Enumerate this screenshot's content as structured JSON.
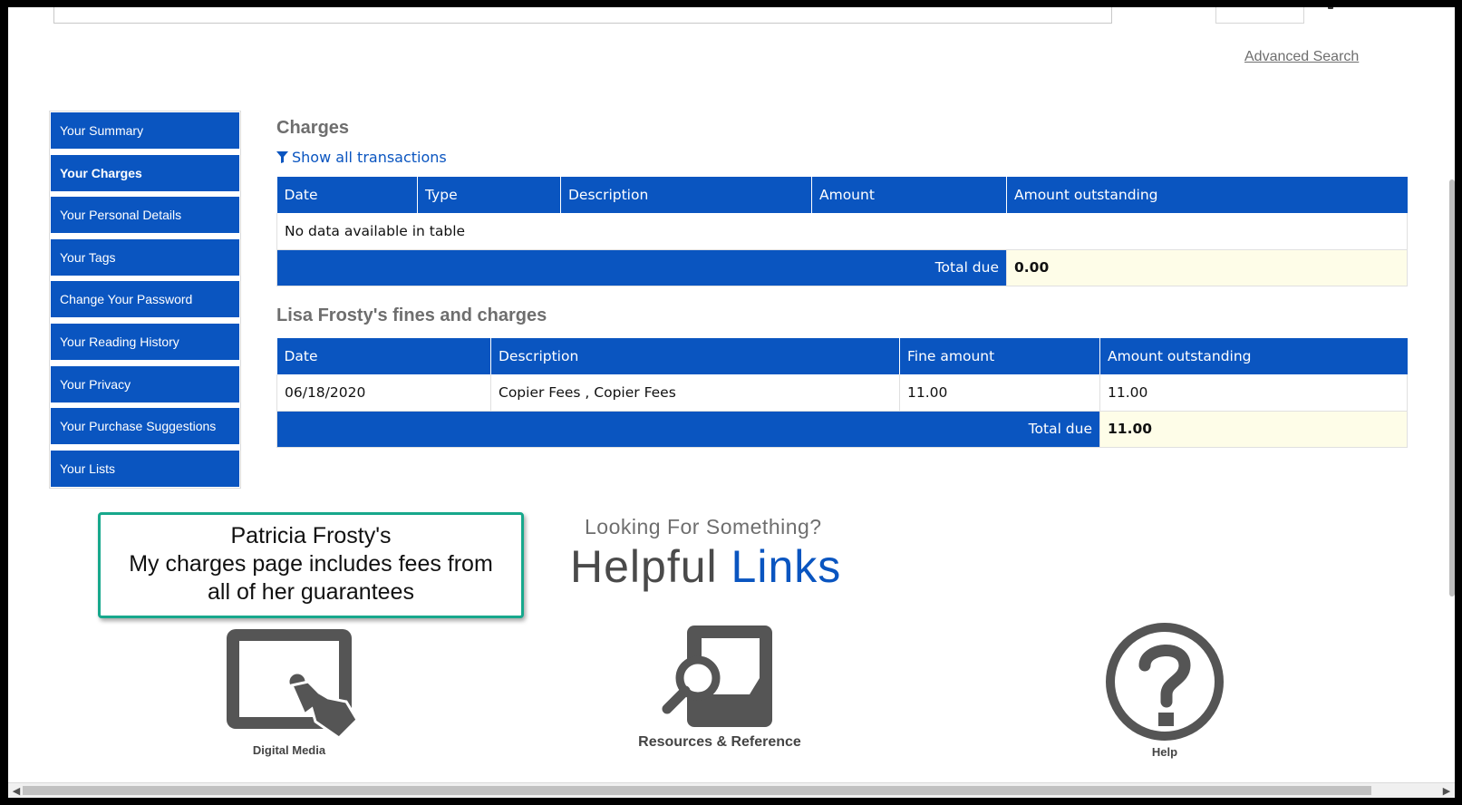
{
  "header": {
    "advanced_search": "Advanced Search"
  },
  "sidebar": {
    "items": [
      {
        "label": "Your Summary"
      },
      {
        "label": "Your Charges"
      },
      {
        "label": "Your Personal Details"
      },
      {
        "label": "Your Tags"
      },
      {
        "label": "Change Your Password"
      },
      {
        "label": "Your Reading History"
      },
      {
        "label": "Your Privacy"
      },
      {
        "label": "Your Purchase Suggestions"
      },
      {
        "label": "Your Lists"
      }
    ],
    "active": "Your Charges"
  },
  "charges": {
    "title": "Charges",
    "show_all": "Show all transactions",
    "columns": [
      "Date",
      "Type",
      "Description",
      "Amount",
      "Amount outstanding"
    ],
    "empty_message": "No data available in table",
    "total_label": "Total due",
    "total_value": "0.00"
  },
  "fines": {
    "title": "Lisa Frosty's fines and charges",
    "columns": [
      "Date",
      "Description",
      "Fine amount",
      "Amount outstanding"
    ],
    "rows": [
      {
        "date": "06/18/2020",
        "description": "Copier Fees , Copier Fees",
        "fine_amount": "11.00",
        "amount_outstanding": "11.00"
      }
    ],
    "total_label": "Total due",
    "total_value": "11.00"
  },
  "callout": {
    "line1": "Patricia Frosty's",
    "line2": "My charges page includes fees from",
    "line3": "all of her guarantees",
    "border_color": "#17a88c"
  },
  "helpful_links": {
    "subtitle": "Looking For Something?",
    "title_part1": "Helpful",
    "title_part2": "Links",
    "tiles": [
      {
        "label": "Digital Media",
        "icon": "tablet-touch-icon"
      },
      {
        "label": "Resources & Reference",
        "icon": "search-document-icon"
      },
      {
        "label": "Help",
        "icon": "question-circle-icon"
      }
    ]
  },
  "colors": {
    "accent": "#0a55c0",
    "total_value_bg": "#fefde8",
    "heading_gray": "#6e6e6e"
  }
}
